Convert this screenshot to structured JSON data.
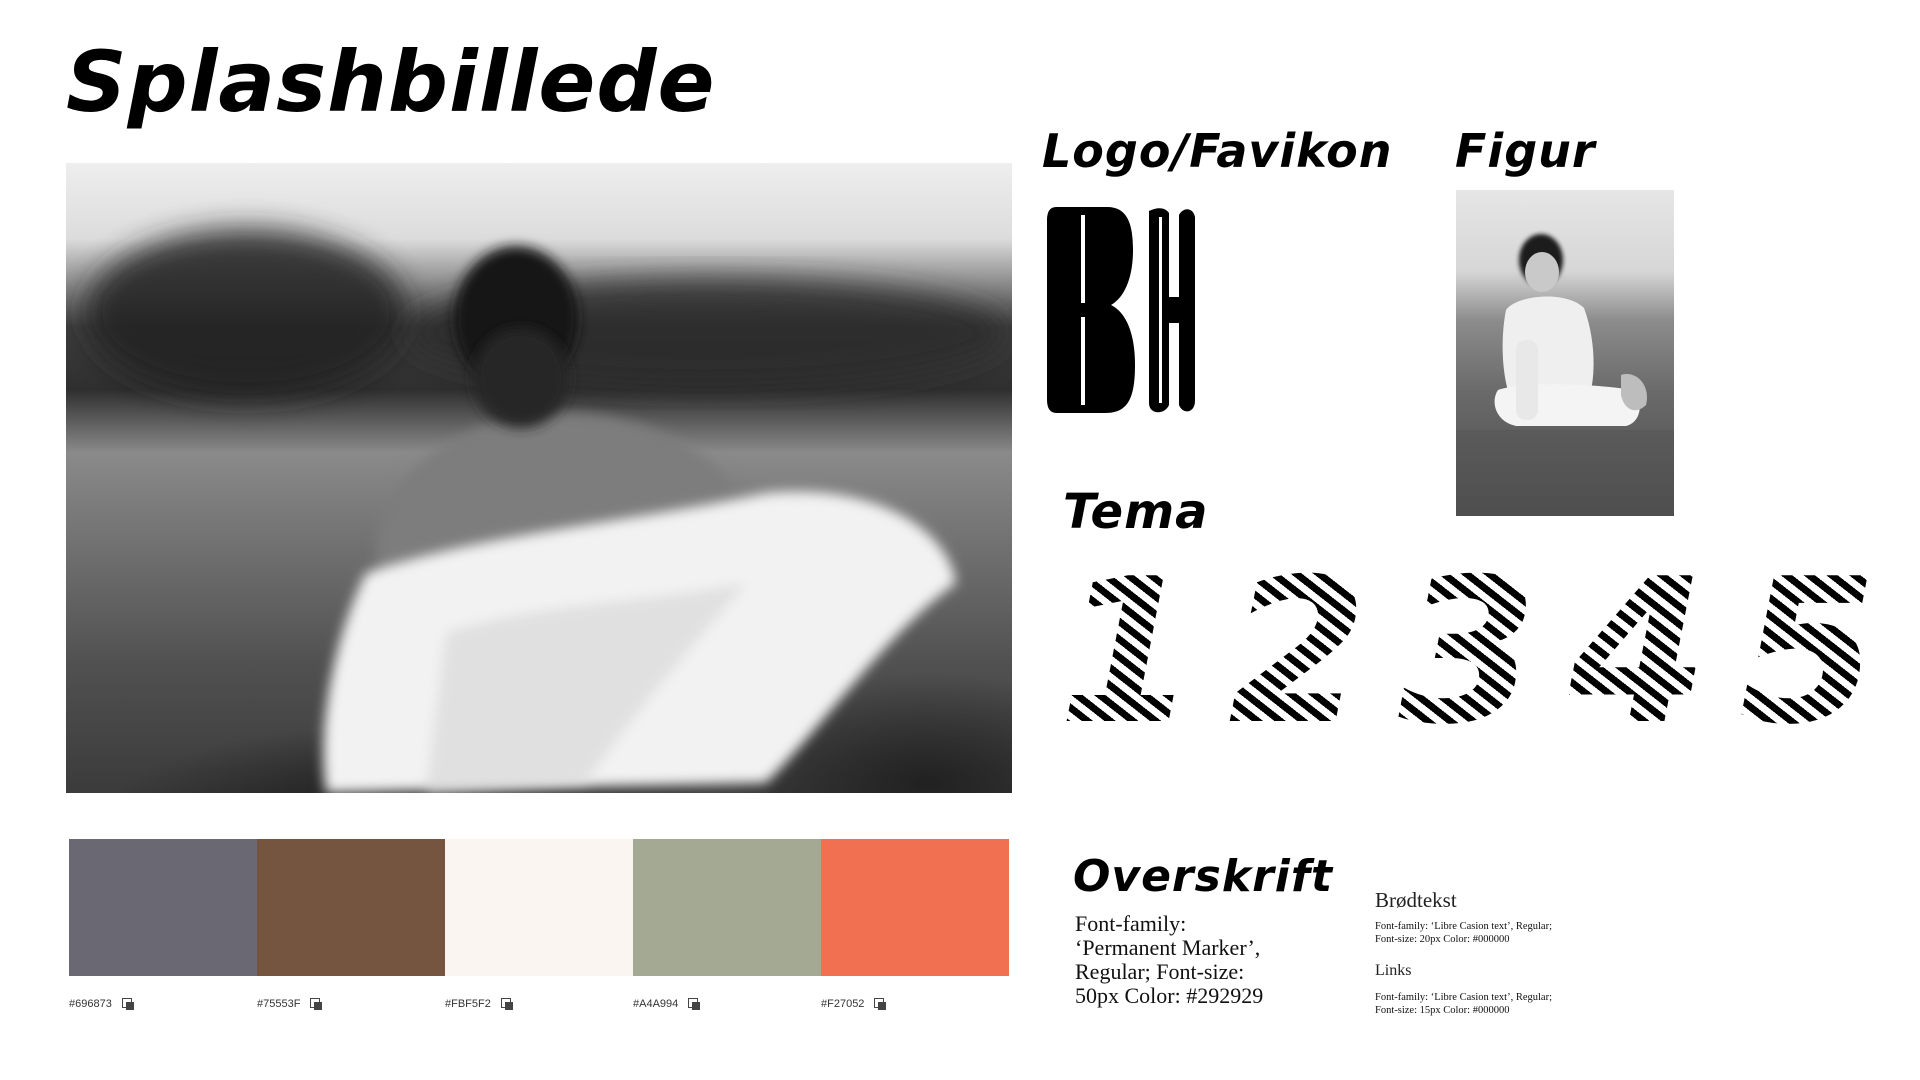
{
  "page": {
    "title": "Splashbillede"
  },
  "logo": {
    "heading": "Logo/Favikon"
  },
  "figure": {
    "heading": "Figur"
  },
  "theme": {
    "heading": "Tema",
    "numbers": [
      "1",
      "2",
      "3",
      "4",
      "5"
    ]
  },
  "palette": {
    "colors": [
      {
        "hex": "#696873"
      },
      {
        "hex": "#75553F"
      },
      {
        "hex": "#FBF5F2"
      },
      {
        "hex": "#A4A994"
      },
      {
        "hex": "#F27052"
      }
    ],
    "copy_icon": "copy-icon"
  },
  "typography": {
    "heading": {
      "title": "Overskrift",
      "spec": "Font-family: ‘Permanent Marker’, Regular; Font-size: 50px Color: #292929"
    },
    "body": {
      "title": "Brødtekst",
      "spec_line1": "Font-family: ‘Libre Casion text’, Regular;",
      "spec_line2": "Font-size: 20px  Color: #000000"
    },
    "links": {
      "title": "Links",
      "spec_line1": "Font-family: ‘Libre Casion text’, Regular;",
      "spec_line2": "Font-size: 15px  Color: #000000"
    }
  }
}
